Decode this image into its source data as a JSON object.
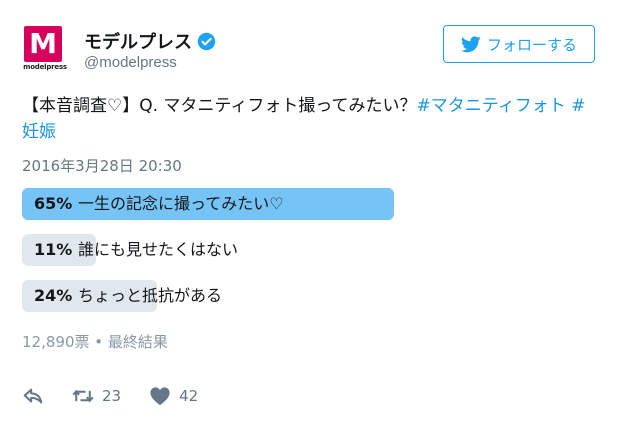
{
  "profile": {
    "display_name": "モデルプレス",
    "handle": "@modelpress",
    "logo_letter": "M",
    "logo_word": "modelpress"
  },
  "follow": {
    "label": "フォローする"
  },
  "tweet": {
    "text_parts": [
      "【本音調査♡】Q. マタニティフォト撮ってみたい？",
      "#マタニティフォト",
      " ",
      "#",
      "妊娠"
    ],
    "timestamp": "2016年3月28日 20:30"
  },
  "poll": {
    "options": [
      {
        "percent": "65%",
        "label": "一生の記念に撮ってみたい♡",
        "value": 65,
        "winner": true
      },
      {
        "percent": "11%",
        "label": "誰にも見せたくはない",
        "value": 11,
        "winner": false
      },
      {
        "percent": "24%",
        "label": "ちょっと抵抗がある",
        "value": 24,
        "winner": false
      }
    ],
    "meta": "12,890票 • 最終結果"
  },
  "actions": {
    "retweets": "23",
    "likes": "42"
  },
  "colors": {
    "accent": "#1da1f2",
    "poll_winner": "#76c3f6",
    "poll_other": "#e1e8ed",
    "logo": "#d6005c"
  }
}
